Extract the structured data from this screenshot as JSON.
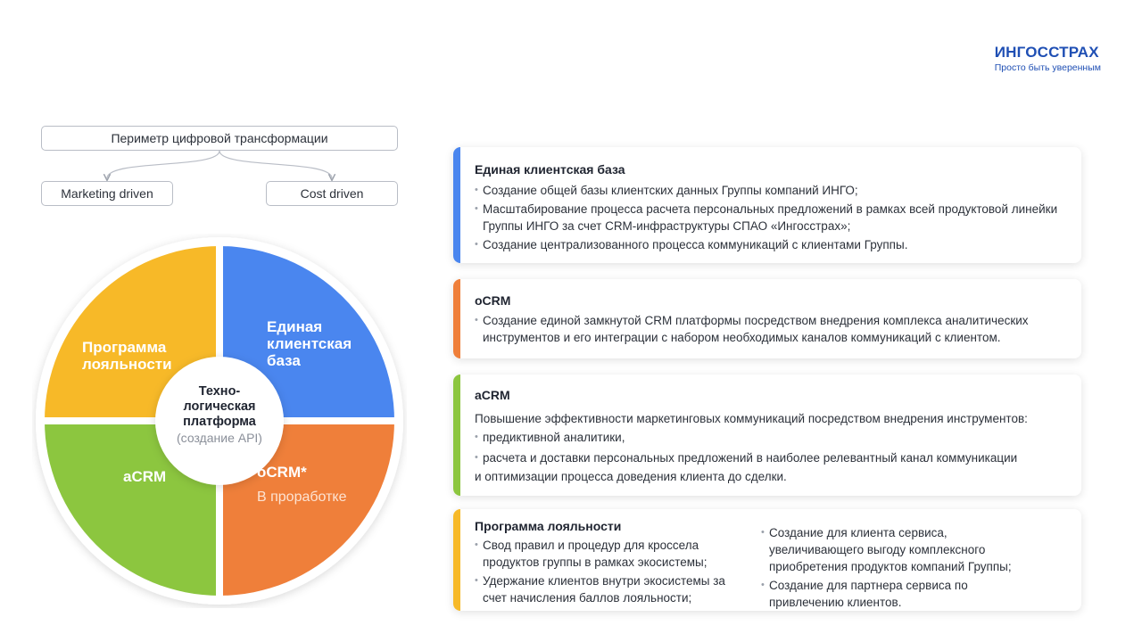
{
  "logo": {
    "name": "ИНГОССТРАХ",
    "slogan": "Просто быть уверенным"
  },
  "perimeter": {
    "main": "Периметр цифровой трансформации",
    "left": "Marketing driven",
    "right": "Cost driven"
  },
  "wheel": {
    "loyalty": [
      "Программа",
      "лояльности"
    ],
    "base": [
      "Единая",
      "клиентская",
      "база"
    ],
    "acrm": "aCRM",
    "ocrm": "oCRM*",
    "ocrm_sub": "В проработке",
    "center": [
      "Техно-",
      "логическая",
      "платформа"
    ],
    "center_sub": "(создание API)",
    "colors": {
      "loyalty": "#f7b928",
      "base": "#4a86ef",
      "acrm": "#8cc63f",
      "ocrm": "#ef7f3a"
    }
  },
  "cards": {
    "base": {
      "title": "Единая клиентская база",
      "accent": "#4a86ef",
      "items": [
        "Создание общей базы клиентских данных Группы компаний ИНГО;",
        "Масштабирование процесса расчета персональных предложений в рамках всей продуктовой линейки Группы ИНГО за счет CRM-инфраструктуры СПАО «Ингосстрах»;",
        "Создание централизованного процесса коммуникаций с клиентами Группы."
      ]
    },
    "ocrm": {
      "title": "oCRM",
      "accent": "#ef7f3a",
      "items": [
        "Создание единой замкнутой CRM платформы посредством внедрения комплекса аналитических инструментов и его интеграции с набором необходимых каналов коммуникаций с клиентом."
      ]
    },
    "acrm": {
      "title": "aCRM",
      "accent": "#8cc63f",
      "intro": "Повышение эффективности маркетинговых коммуникаций посредством внедрения инструментов:",
      "items": [
        "предиктивной аналитики,",
        "расчета и доставки персональных предложений в наиболее релевантный канал коммуникации"
      ],
      "outro": "и оптимизации процесса доведения клиента до сделки."
    },
    "loyalty": {
      "title": "Программа лояльности",
      "accent": "#f7b928",
      "left": [
        "Свод правил и процедур для кроссела продуктов группы в рамках экосистемы;",
        "Удержание клиентов внутри экосистемы за счет начисления баллов лояльности;"
      ],
      "right": [
        "Создание для клиента сервиса, увеличивающего выгоду комплексного приобретения продуктов компаний Группы;",
        "Создание для партнера сервиса по привлечению клиентов."
      ]
    }
  }
}
